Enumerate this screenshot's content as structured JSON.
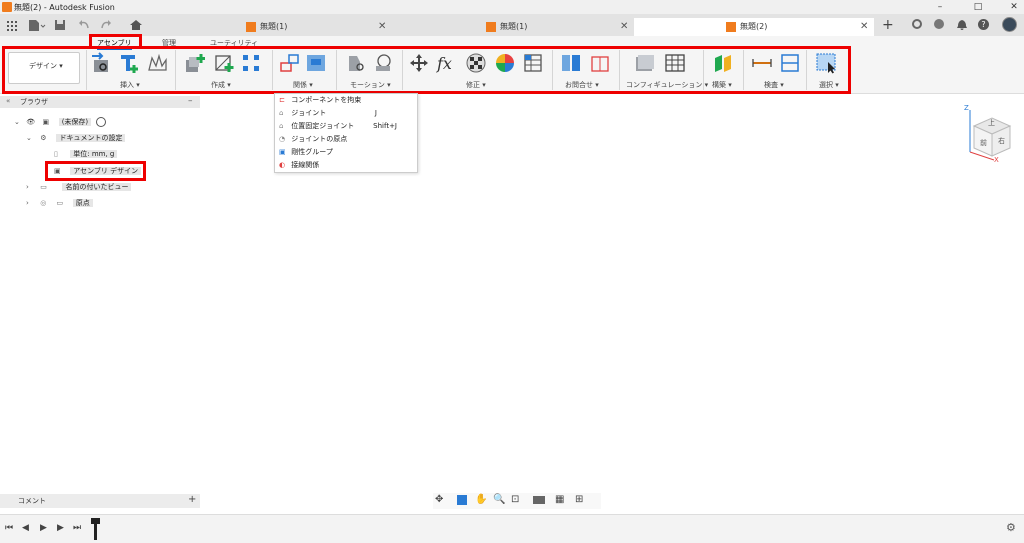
{
  "window": {
    "title": "無題(2) - Autodesk Fusion"
  },
  "doc_tabs": [
    {
      "label": "無題(1)"
    },
    {
      "label": "無題(1)"
    },
    {
      "label": "無題(2)"
    }
  ],
  "ribbon_tabs": [
    {
      "label": "アセンブリ"
    },
    {
      "label": "管理"
    },
    {
      "label": "ユーティリティ"
    }
  ],
  "workspace": {
    "label": "デザイン ▾"
  },
  "groups": {
    "insert": "挿入 ▾",
    "create": "作成 ▾",
    "relation": "関係 ▾",
    "motion": "モーション ▾",
    "modify": "修正 ▾",
    "query": "お問合せ ▾",
    "configuration": "コンフィギュレーション ▾",
    "construct": "構築 ▾",
    "inspect": "検査 ▾",
    "select": "選択 ▾"
  },
  "relation_menu": [
    {
      "label": "コンポーネントを拘束",
      "shortcut": ""
    },
    {
      "label": "ジョイント",
      "shortcut": "J"
    },
    {
      "label": "位置固定ジョイント",
      "shortcut": "Shift+J"
    },
    {
      "label": "ジョイントの原点",
      "shortcut": ""
    },
    {
      "label": "剛性グループ",
      "shortcut": ""
    },
    {
      "label": "接線関係",
      "shortcut": ""
    }
  ],
  "browser": {
    "title": "ブラウザ",
    "root": "(未保存)",
    "doc_settings": "ドキュメントの設定",
    "units": "単位: mm, g",
    "design_type": "アセンブリ デザイン",
    "named_views": "名前の付いたビュー",
    "origin": "原点"
  },
  "comment": {
    "label": "コメント"
  },
  "viewcube": {
    "top": "上",
    "front": "前",
    "right": "右",
    "axis_z": "Z",
    "axis_x": "X"
  },
  "colors": {
    "highlight": "#ee0000",
    "accent": "#0a6ed1",
    "orange": "#f07c1e"
  }
}
